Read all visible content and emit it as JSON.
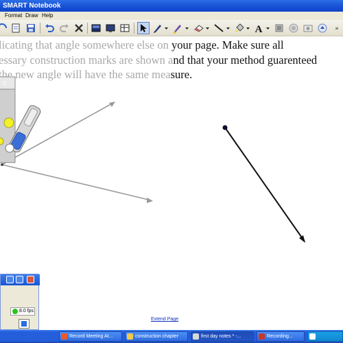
{
  "window": {
    "title": "SMART Notebook"
  },
  "menu": [
    "Format",
    "Draw",
    "Help"
  ],
  "toolbar": {
    "icons": [
      "save-icon",
      "document-icon",
      "undo-icon",
      "redo-icon",
      "delete-icon",
      "screen-shade-icon",
      "table-icon",
      "select-arrow-icon",
      "pen-icon",
      "creative-pen-icon",
      "eraser-icon",
      "line-icon",
      "fill-icon",
      "text-icon",
      "properties-icon",
      "record-icon",
      "capture-icon",
      "more-icon"
    ]
  },
  "page": {
    "line1_faded": "licating that angle somewhere else on",
    "line1_dark": " your page.  Make sure all",
    "line2_faded": "essary construction marks are shown a",
    "line2_dark": "nd that your method guarenteed",
    "line3_faded": " the new angle will have the same mea",
    "line3_dark": "sure.",
    "extend_link": "Extend Page"
  },
  "recorder": {
    "fps": "8.0 fps"
  },
  "taskbar": {
    "items": [
      {
        "label": "Record Meeting At..."
      },
      {
        "label": "construction chapter"
      },
      {
        "label": "first day notes * -..."
      },
      {
        "label": "Recording..."
      }
    ]
  },
  "colors": {
    "title_bar": "#1b55d8",
    "taskbar": "#245edb",
    "faded_text": "#a8a8a8"
  }
}
